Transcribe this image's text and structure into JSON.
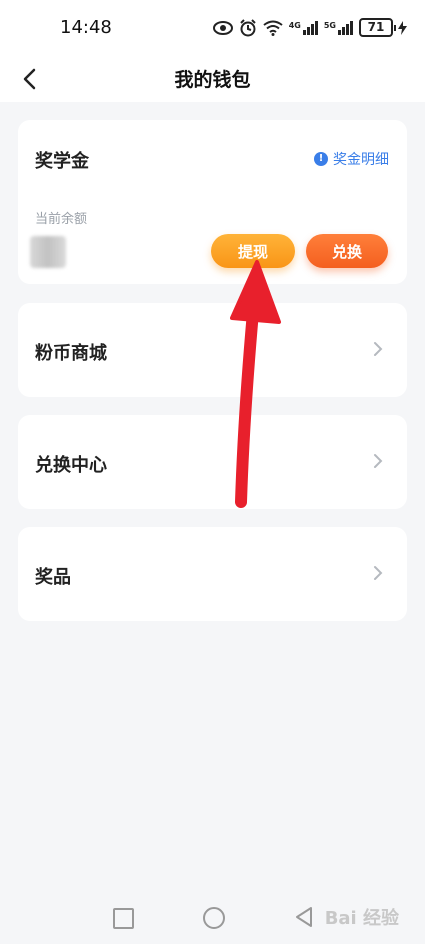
{
  "status_bar": {
    "time": "14:48",
    "network_1": "4G",
    "network_2": "5G",
    "battery": "71"
  },
  "header": {
    "title": "我的钱包"
  },
  "wallet": {
    "title": "奖学金",
    "detail_link": "奖金明细",
    "balance_label": "当前余额",
    "withdraw_label": "提现",
    "exchange_label": "兑换"
  },
  "menu": {
    "items": [
      {
        "label": "粉币商城"
      },
      {
        "label": "兑换中心"
      },
      {
        "label": "奖品"
      }
    ]
  },
  "watermark": "Bai 经验",
  "colors": {
    "accent_blue": "#3a7ee8",
    "withdraw_orange": "#f99517",
    "exchange_orange": "#f45f1f",
    "annotation_red": "#e8202c"
  }
}
